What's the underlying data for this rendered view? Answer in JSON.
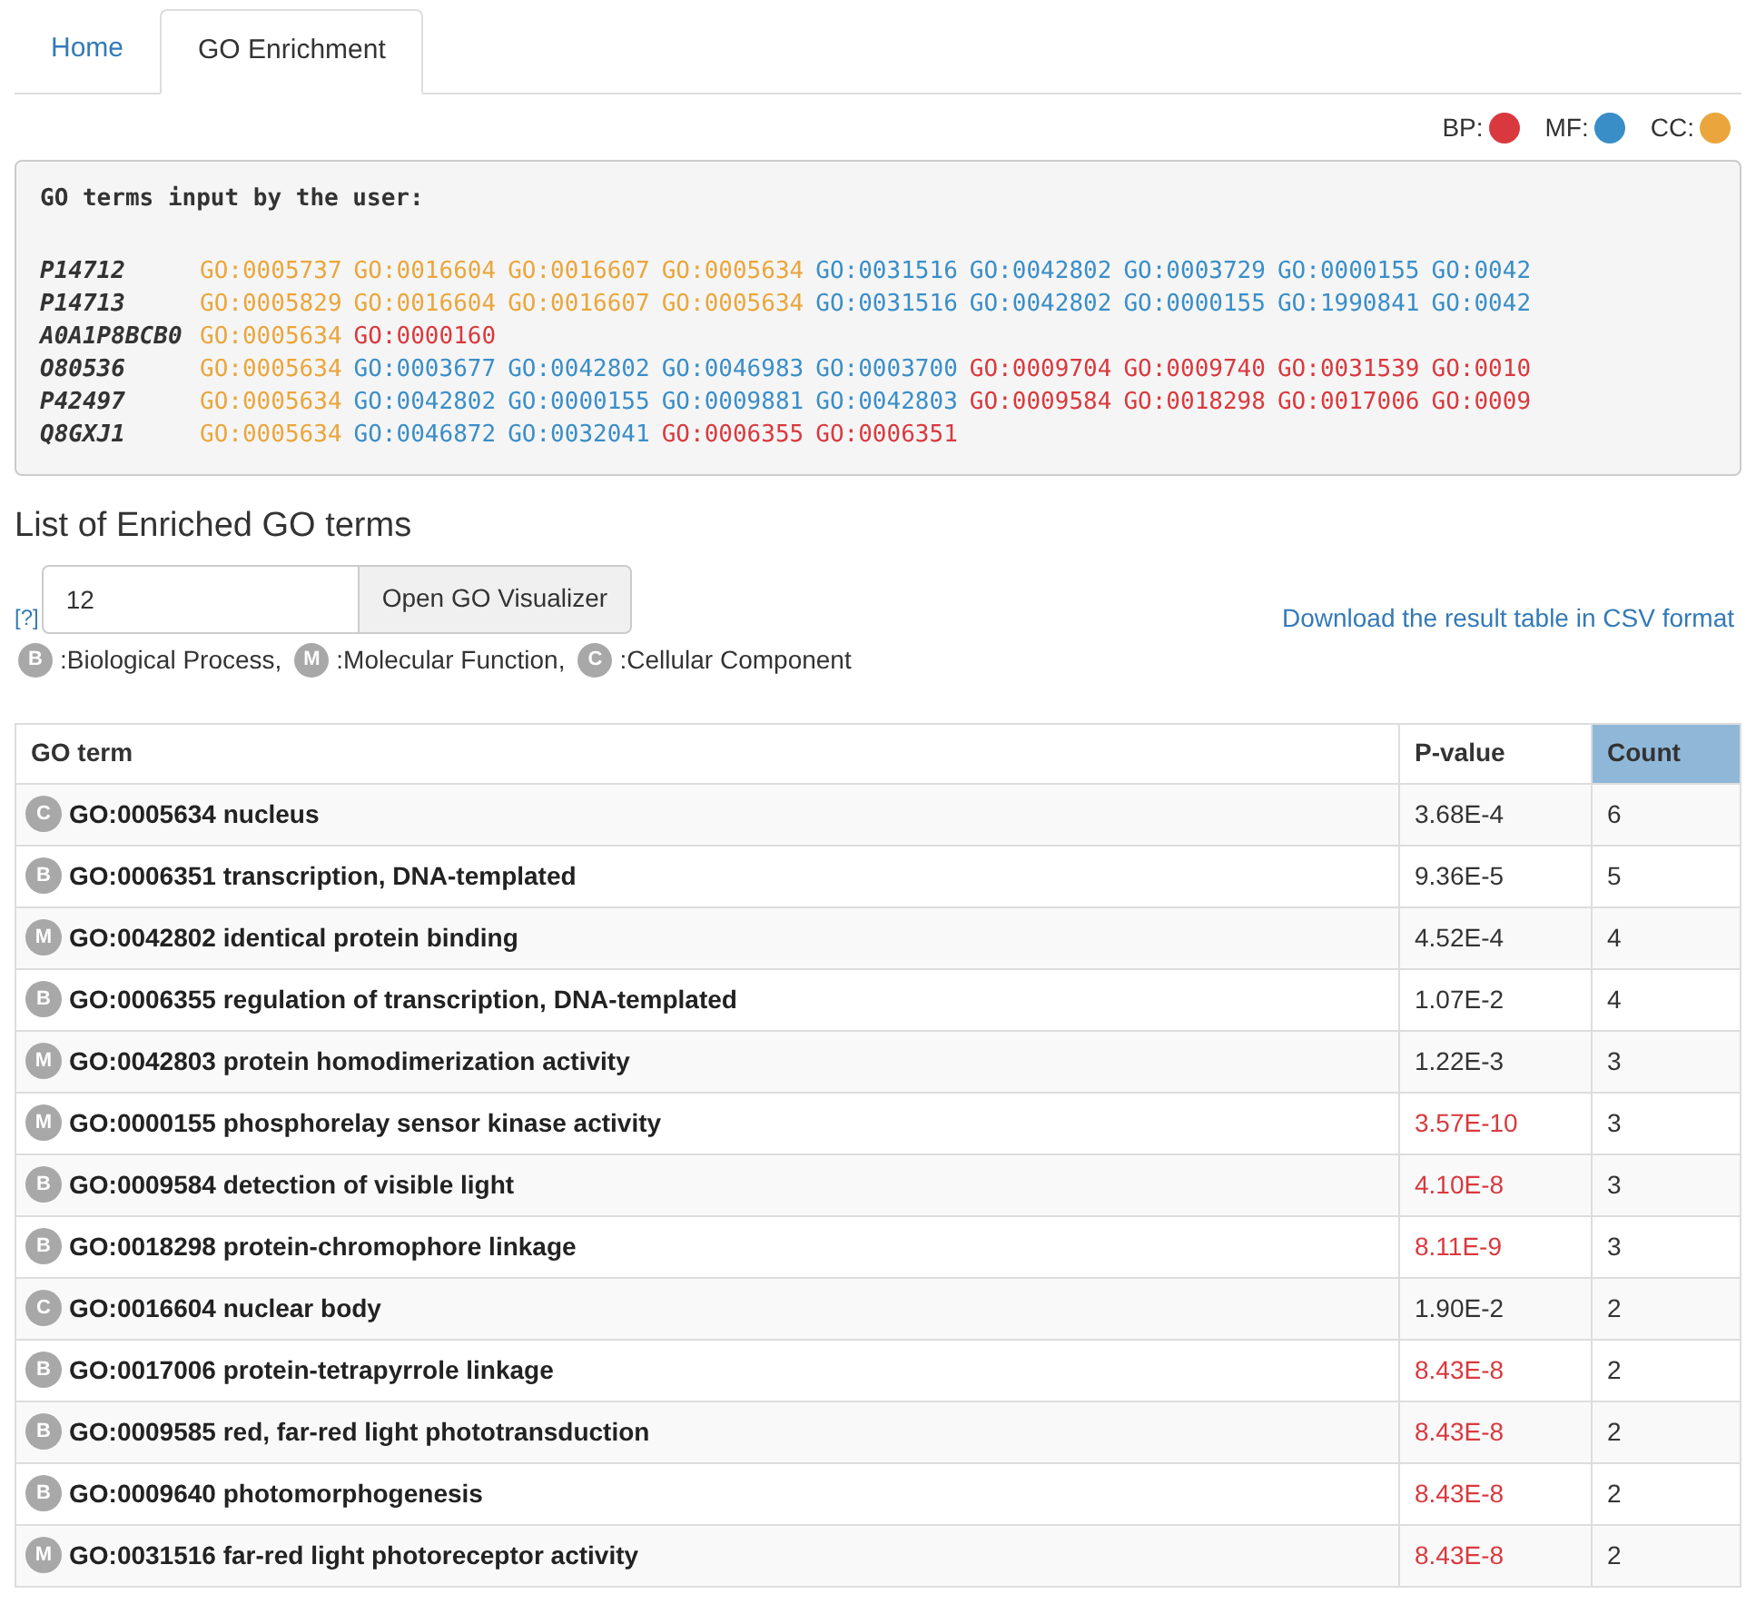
{
  "tabs": [
    {
      "label": "Home",
      "selected": false
    },
    {
      "label": "GO Enrichment",
      "selected": true
    }
  ],
  "legend": [
    {
      "label": "BP:",
      "color": "#d9393e"
    },
    {
      "label": "MF:",
      "color": "#3a8ec8"
    },
    {
      "label": "CC:",
      "color": "#eaa63c"
    }
  ],
  "input_box": {
    "title": "GO terms input by the user:",
    "proteins": [
      {
        "id": "P14712",
        "terms": [
          {
            "code": "GO:0005737",
            "kind": "cc"
          },
          {
            "code": "GO:0016604",
            "kind": "cc"
          },
          {
            "code": "GO:0016607",
            "kind": "cc"
          },
          {
            "code": "GO:0005634",
            "kind": "cc"
          },
          {
            "code": "GO:0031516",
            "kind": "mf"
          },
          {
            "code": "GO:0042802",
            "kind": "mf"
          },
          {
            "code": "GO:0003729",
            "kind": "mf"
          },
          {
            "code": "GO:0000155",
            "kind": "mf"
          },
          {
            "code": "GO:0042",
            "kind": "mf"
          }
        ]
      },
      {
        "id": "P14713",
        "terms": [
          {
            "code": "GO:0005829",
            "kind": "cc"
          },
          {
            "code": "GO:0016604",
            "kind": "cc"
          },
          {
            "code": "GO:0016607",
            "kind": "cc"
          },
          {
            "code": "GO:0005634",
            "kind": "cc"
          },
          {
            "code": "GO:0031516",
            "kind": "mf"
          },
          {
            "code": "GO:0042802",
            "kind": "mf"
          },
          {
            "code": "GO:0000155",
            "kind": "mf"
          },
          {
            "code": "GO:1990841",
            "kind": "mf"
          },
          {
            "code": "GO:0042",
            "kind": "mf"
          }
        ]
      },
      {
        "id": "A0A1P8BCB0",
        "terms": [
          {
            "code": "GO:0005634",
            "kind": "cc"
          },
          {
            "code": "GO:0000160",
            "kind": "bp"
          }
        ]
      },
      {
        "id": "O80536",
        "terms": [
          {
            "code": "GO:0005634",
            "kind": "cc"
          },
          {
            "code": "GO:0003677",
            "kind": "mf"
          },
          {
            "code": "GO:0042802",
            "kind": "mf"
          },
          {
            "code": "GO:0046983",
            "kind": "mf"
          },
          {
            "code": "GO:0003700",
            "kind": "mf"
          },
          {
            "code": "GO:0009704",
            "kind": "bp"
          },
          {
            "code": "GO:0009740",
            "kind": "bp"
          },
          {
            "code": "GO:0031539",
            "kind": "bp"
          },
          {
            "code": "GO:0010",
            "kind": "bp"
          }
        ]
      },
      {
        "id": "P42497",
        "terms": [
          {
            "code": "GO:0005634",
            "kind": "cc"
          },
          {
            "code": "GO:0042802",
            "kind": "mf"
          },
          {
            "code": "GO:0000155",
            "kind": "mf"
          },
          {
            "code": "GO:0009881",
            "kind": "mf"
          },
          {
            "code": "GO:0042803",
            "kind": "mf"
          },
          {
            "code": "GO:0009584",
            "kind": "bp"
          },
          {
            "code": "GO:0018298",
            "kind": "bp"
          },
          {
            "code": "GO:0017006",
            "kind": "bp"
          },
          {
            "code": "GO:0009",
            "kind": "bp"
          }
        ]
      },
      {
        "id": "Q8GXJ1",
        "terms": [
          {
            "code": "GO:0005634",
            "kind": "cc"
          },
          {
            "code": "GO:0046872",
            "kind": "mf"
          },
          {
            "code": "GO:0032041",
            "kind": "mf"
          },
          {
            "code": "GO:0006355",
            "kind": "bp"
          },
          {
            "code": "GO:0006351",
            "kind": "bp"
          }
        ]
      }
    ]
  },
  "section_title": "List of Enriched GO terms",
  "help_link": "[?]",
  "number_field": {
    "value": "12"
  },
  "visualizer_button": "Open GO Visualizer",
  "download_link": "Download the result table in CSV format",
  "category_legend": [
    {
      "letter": "B",
      "label": ":Biological Process,"
    },
    {
      "letter": "M",
      "label": ":Molecular Function,"
    },
    {
      "letter": "C",
      "label": ":Cellular Component"
    }
  ],
  "table": {
    "columns": [
      {
        "label": "GO term",
        "sorted": false
      },
      {
        "label": "P-value",
        "sorted": false
      },
      {
        "label": "Count",
        "sorted": true
      }
    ],
    "rows": [
      {
        "badge": "C",
        "id": "GO:0005634",
        "name": "nucleus",
        "p_value": "3.68E-4",
        "significant": false,
        "count": "6"
      },
      {
        "badge": "B",
        "id": "GO:0006351",
        "name": "transcription, DNA-templated",
        "p_value": "9.36E-5",
        "significant": false,
        "count": "5"
      },
      {
        "badge": "M",
        "id": "GO:0042802",
        "name": "identical protein binding",
        "p_value": "4.52E-4",
        "significant": false,
        "count": "4"
      },
      {
        "badge": "B",
        "id": "GO:0006355",
        "name": "regulation of transcription, DNA-templated",
        "p_value": "1.07E-2",
        "significant": false,
        "count": "4"
      },
      {
        "badge": "M",
        "id": "GO:0042803",
        "name": "protein homodimerization activity",
        "p_value": "1.22E-3",
        "significant": false,
        "count": "3"
      },
      {
        "badge": "M",
        "id": "GO:0000155",
        "name": "phosphorelay sensor kinase activity",
        "p_value": "3.57E-10",
        "significant": true,
        "count": "3"
      },
      {
        "badge": "B",
        "id": "GO:0009584",
        "name": "detection of visible light",
        "p_value": "4.10E-8",
        "significant": true,
        "count": "3"
      },
      {
        "badge": "B",
        "id": "GO:0018298",
        "name": "protein-chromophore linkage",
        "p_value": "8.11E-9",
        "significant": true,
        "count": "3"
      },
      {
        "badge": "C",
        "id": "GO:0016604",
        "name": "nuclear body",
        "p_value": "1.90E-2",
        "significant": false,
        "count": "2"
      },
      {
        "badge": "B",
        "id": "GO:0017006",
        "name": "protein-tetrapyrrole linkage",
        "p_value": "8.43E-8",
        "significant": true,
        "count": "2"
      },
      {
        "badge": "B",
        "id": "GO:0009585",
        "name": "red, far-red light phototransduction",
        "p_value": "8.43E-8",
        "significant": true,
        "count": "2"
      },
      {
        "badge": "B",
        "id": "GO:0009640",
        "name": "photomorphogenesis",
        "p_value": "8.43E-8",
        "significant": true,
        "count": "2"
      },
      {
        "badge": "M",
        "id": "GO:0031516",
        "name": "far-red light photoreceptor activity",
        "p_value": "8.43E-8",
        "significant": true,
        "count": "2"
      }
    ]
  }
}
